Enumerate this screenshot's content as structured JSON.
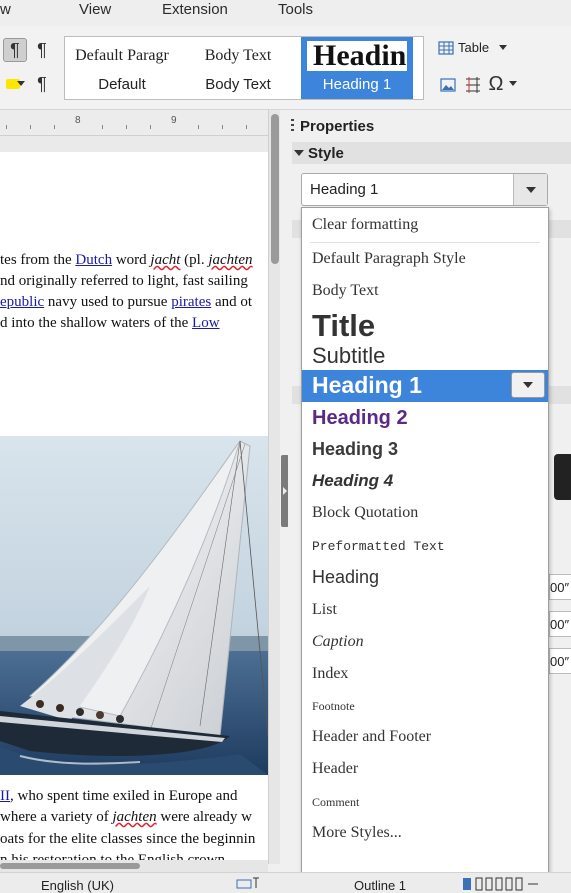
{
  "menubar": {
    "items": [
      "View",
      "Extension",
      "Tools"
    ]
  },
  "toolbar": {
    "styles_gallery": [
      {
        "preview": "Default Paragr",
        "label": "Default"
      },
      {
        "preview": "Body Text",
        "label": "Body Text"
      },
      {
        "preview": "Headin",
        "label": "Heading 1",
        "selected": true
      }
    ],
    "table_label": "Table"
  },
  "ruler": {
    "numbers": [
      "8",
      "9"
    ]
  },
  "document": {
    "lines": {
      "l1a": "tes from the ",
      "l1b": "Dutch",
      "l1c": " word ",
      "l1d": "jacht",
      "l1e": " (pl. ",
      "l1f": "jachten",
      "l2": "nd originally referred to light, fast sailing",
      "l3a": "epublic",
      "l3b": " navy used to pursue ",
      "l3c": "pirates",
      "l3d": " and ot",
      "l4a": "d into the shallow waters of the ",
      "l4b": "Low ",
      "l5a": "II",
      "l5b": ", who spent time exiled in Europe and",
      "l6a": "where a variety of ",
      "l6b": "jachten",
      "l6c": " were already w",
      "l7": "oats for the elite classes since the beginnin",
      "l8": "n his restoration to the English crown,"
    },
    "image": "sailing-yacht-photo"
  },
  "sidebar": {
    "title": "Properties",
    "section": "Style",
    "combo_value": "Heading 1"
  },
  "dropdown": {
    "items": [
      {
        "label": "Clear formatting"
      },
      {
        "label": "Default Paragraph Style"
      },
      {
        "label": "Body Text"
      },
      {
        "label": "Title"
      },
      {
        "label": "Subtitle"
      },
      {
        "label": "Heading 1",
        "selected": true
      },
      {
        "label": "Heading 2"
      },
      {
        "label": "Heading 3"
      },
      {
        "label": "Heading 4"
      },
      {
        "label": "Block Quotation"
      },
      {
        "label": "Preformatted Text"
      },
      {
        "label": "Heading"
      },
      {
        "label": "List"
      },
      {
        "label": "Caption"
      },
      {
        "label": "Index"
      },
      {
        "label": "Footnote"
      },
      {
        "label": "Header and Footer"
      },
      {
        "label": "Header"
      },
      {
        "label": "Comment"
      },
      {
        "label": "More Styles..."
      }
    ]
  },
  "statusbar": {
    "language": "English (UK)",
    "outline": "Outline 1"
  },
  "colors": {
    "accent": "#3d84db",
    "link": "#1a1aa6",
    "heading2": "#5b2a86"
  }
}
